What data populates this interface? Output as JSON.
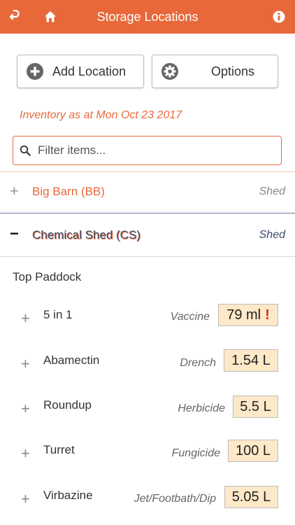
{
  "header": {
    "title": "Storage Locations",
    "colors": {
      "bar": "#e8683a",
      "text": "#ffffff"
    }
  },
  "actions": {
    "add_location_label": "Add Location",
    "options_label": "Options"
  },
  "inventory_date": "Inventory as at Mon Oct 23 2017",
  "filter": {
    "placeholder": "Filter items..."
  },
  "locations": [
    {
      "sign": "+",
      "name": "Big Barn (BB)",
      "type": "Shed",
      "expanded": false
    },
    {
      "sign": "−",
      "name": "Chemical Shed (CS)",
      "type": "Shed",
      "expanded": true
    }
  ],
  "section": "Top Paddock",
  "items": [
    {
      "name": "5 in 1",
      "category": "Vaccine",
      "quantity": "79 ml",
      "alert": "!"
    },
    {
      "name": "Abamectin",
      "category": "Drench",
      "quantity": "1.54 L",
      "alert": ""
    },
    {
      "name": "Roundup",
      "category": "Herbicide",
      "quantity": "5.5 L",
      "alert": ""
    },
    {
      "name": "Turret",
      "category": "Fungicide",
      "quantity": "100 L",
      "alert": ""
    },
    {
      "name": "Virbazine",
      "category": "Jet/Footbath/Dip",
      "quantity": "5.05 L",
      "alert": ""
    }
  ],
  "colors": {
    "accent": "#e8683a",
    "qty_bg": "#fde8c8",
    "alert": "#d42a2a",
    "selected_text": "#3b4a6b"
  }
}
